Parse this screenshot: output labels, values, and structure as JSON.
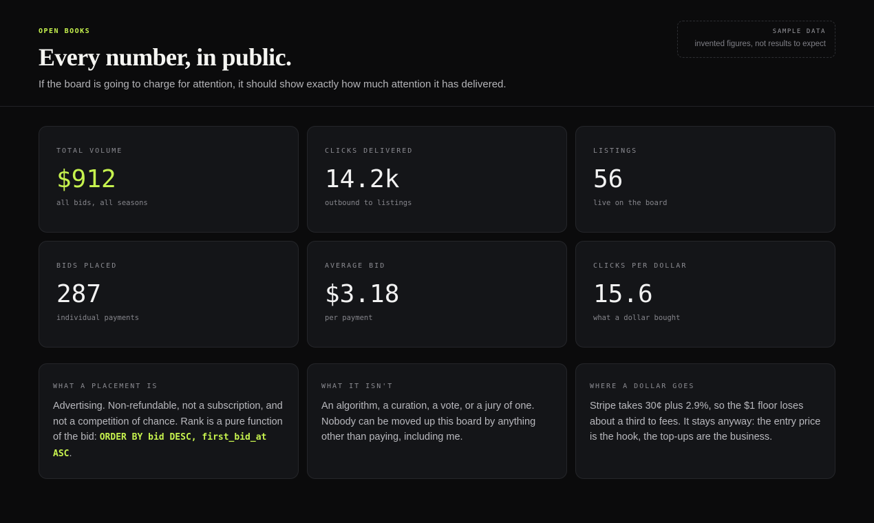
{
  "header": {
    "eyebrow": "OPEN BOOKS",
    "title": "Every number, in public.",
    "subtitle": "If the board is going to charge for attention, it should show exactly how much attention it has delivered.",
    "sample": {
      "title": "SAMPLE DATA",
      "note": "invented figures, not results to expect"
    }
  },
  "stats": [
    {
      "label": "TOTAL VOLUME",
      "value": "$912",
      "note": "all bids, all seasons"
    },
    {
      "label": "CLICKS DELIVERED",
      "value": "14.2k",
      "note": "outbound to listings"
    },
    {
      "label": "LISTINGS",
      "value": "56",
      "note": "live on the board"
    },
    {
      "label": "BIDS PLACED",
      "value": "287",
      "note": "individual payments"
    },
    {
      "label": "AVERAGE BID",
      "value": "$3.18",
      "note": "per payment"
    },
    {
      "label": "CLICKS PER DOLLAR",
      "value": "15.6",
      "note": "what a dollar bought"
    }
  ],
  "info": [
    {
      "label": "WHAT A PLACEMENT IS",
      "text_before": "Advertising. Non-refundable, not a subscription, and not a competition of chance. Rank is a pure function of the bid: ",
      "code": "ORDER BY bid DESC, first_bid_at ASC",
      "text_after": "."
    },
    {
      "label": "WHAT IT ISN'T",
      "text": "An algorithm, a curation, a vote, or a jury of one. Nobody can be moved up this board by anything other than paying, including me."
    },
    {
      "label": "WHERE A DOLLAR GOES",
      "text": "Stripe takes 30¢ plus 2.9%, so the $1 floor loses about a third to fees. It stays anyway: the entry price is the hook, the top-ups are the business."
    }
  ],
  "colors": {
    "accent": "#c6f24e",
    "background": "#0b0b0c",
    "card": "#141518"
  }
}
